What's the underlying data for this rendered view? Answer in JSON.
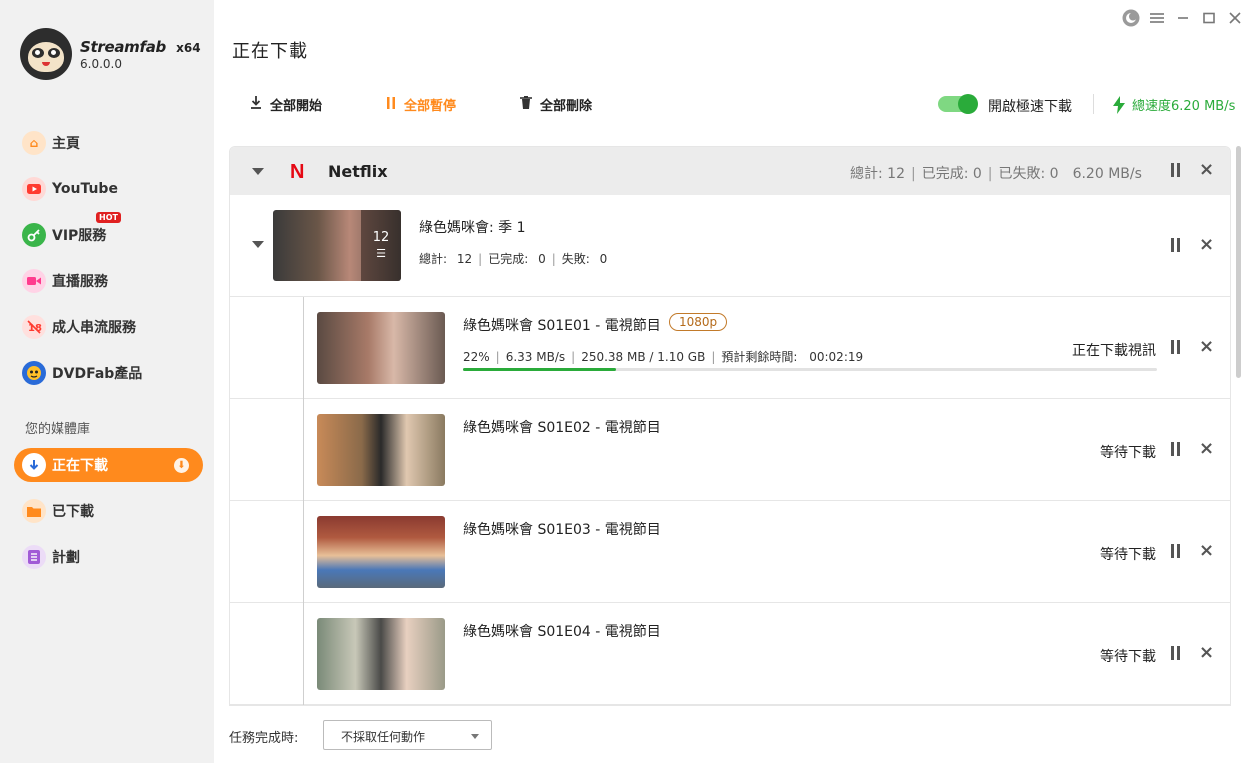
{
  "app": {
    "name": "Streamfab",
    "arch": "x64",
    "version": "6.0.0.0"
  },
  "sidebar": {
    "items": [
      {
        "label": "主頁",
        "icon": "home-icon",
        "color": "#ff8a1d"
      },
      {
        "label": "YouTube",
        "icon": "youtube-icon",
        "color": "#ff3b30"
      },
      {
        "label": "VIP服務",
        "icon": "key-icon",
        "color": "#3ab54a",
        "badge": "HOT"
      },
      {
        "label": "直播服務",
        "icon": "video-camera-icon",
        "color": "#ff3c8e"
      },
      {
        "label": "成人串流服務",
        "icon": "adult-restricted-icon",
        "color": "#ff3b30"
      },
      {
        "label": "DVDFab產品",
        "icon": "dvdfab-logo-icon",
        "color": "#2a6bd8"
      }
    ],
    "library_title": "您的媒體庫",
    "library": [
      {
        "label": "正在下載",
        "icon": "download-icon",
        "active": true
      },
      {
        "label": "已下載",
        "icon": "folder-icon",
        "color": "#ff8a1d"
      },
      {
        "label": "計劃",
        "icon": "schedule-list-icon",
        "color": "#a15bd6"
      }
    ]
  },
  "header": {
    "title": "正在下載"
  },
  "toolbar": {
    "start_all": "全部開始",
    "pause_all": "全部暫停",
    "delete_all": "全部刪除",
    "turbo_label": "開啟極速下載",
    "turbo_on": true,
    "total_speed": "總速度6.20 MB/s"
  },
  "group": {
    "name": "Netflix",
    "logo": "N",
    "total": "總計: 12",
    "done": "已完成: 0",
    "failed": "已失敗: 0",
    "speed": "6.20 MB/s"
  },
  "season": {
    "title": "綠色媽咪會: 季 1",
    "count": "12",
    "stats_total_label": "總計:",
    "stats_total": "12",
    "stats_done_label": "已完成:",
    "stats_done": "0",
    "stats_failed_label": "失敗:",
    "stats_failed": "0"
  },
  "episodes": [
    {
      "title": "綠色媽咪會 S01E01 - 電視節目",
      "quality": "1080p",
      "percent": "22%",
      "progress": 0.22,
      "speed": "6.33 MB/s",
      "size": "250.38 MB / 1.10 GB",
      "eta_label": "預計剩餘時間:",
      "eta": "00:02:19",
      "status": "正在下載視訊"
    },
    {
      "title": "綠色媽咪會 S01E02 - 電視節目",
      "status": "等待下載"
    },
    {
      "title": "綠色媽咪會 S01E03 - 電視節目",
      "status": "等待下載"
    },
    {
      "title": "綠色媽咪會 S01E04 - 電視節目",
      "status": "等待下載"
    }
  ],
  "footer": {
    "label": "任務完成時:",
    "action": "不採取任何動作"
  }
}
